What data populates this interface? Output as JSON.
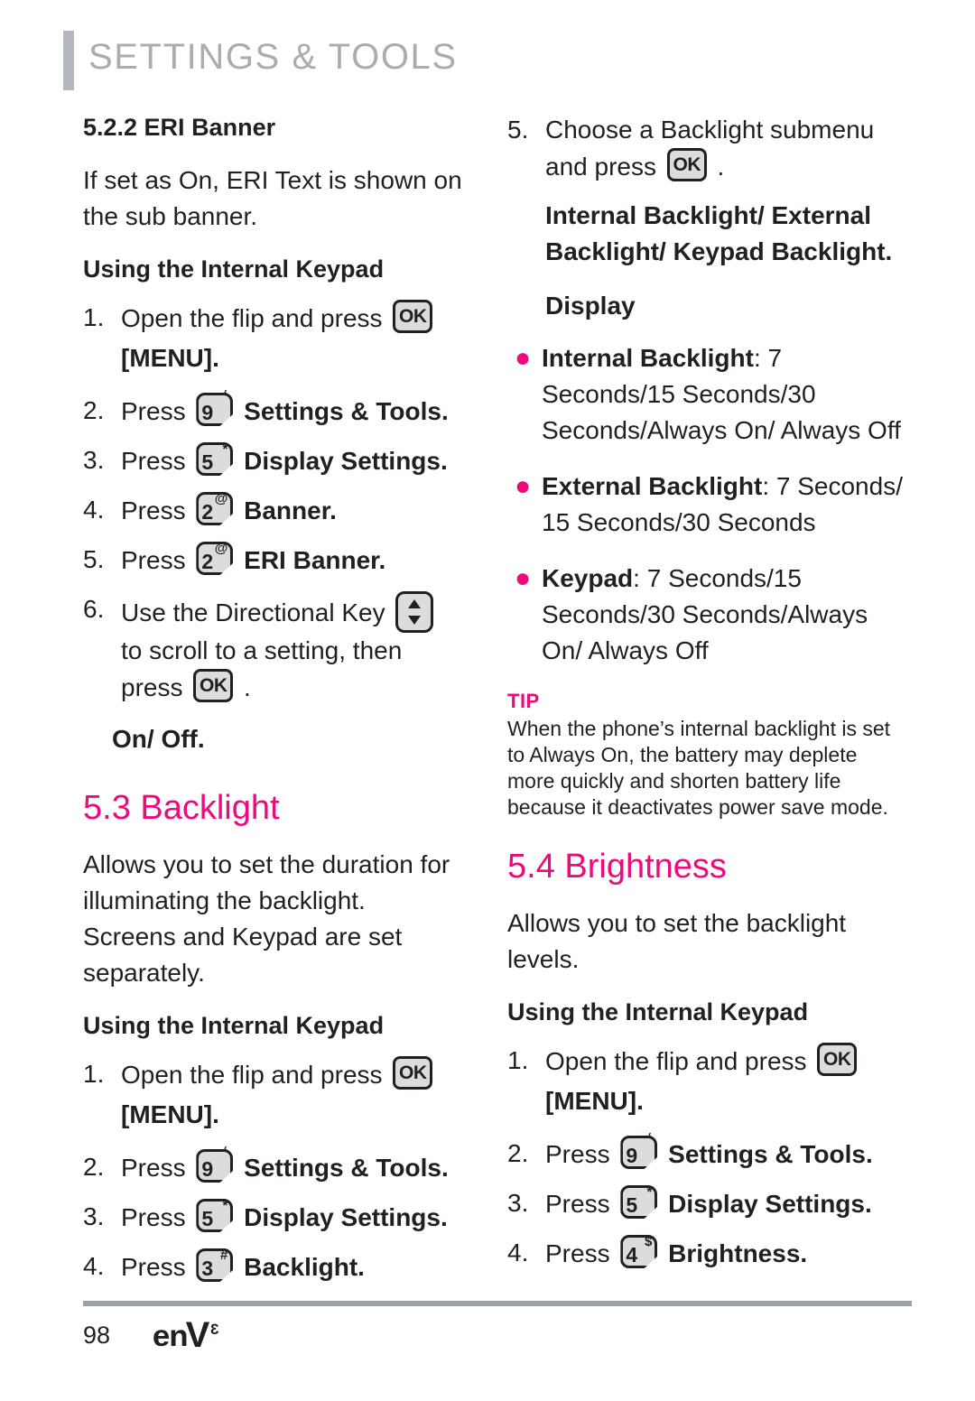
{
  "header": {
    "title": "SETTINGS & TOOLS"
  },
  "footer": {
    "page_number": "98",
    "brand_en": "en",
    "brand_v": "V",
    "brand_sup": "3"
  },
  "colors": {
    "accent": "#EC0A7D",
    "header_gray": "#A9ADB2",
    "rule_gray": "#9AA1A7",
    "key_fill": "#DCDCDC",
    "text": "#231F20"
  },
  "keys": {
    "ok_label": "OK",
    "k9": {
      "digit": "9",
      "sup": "‘"
    },
    "k5": {
      "digit": "5",
      "sup": "*"
    },
    "k2": {
      "digit": "2",
      "sup": "@"
    },
    "k3": {
      "digit": "3",
      "sup": "#"
    },
    "k4": {
      "digit": "4",
      "sup": "$"
    },
    "directional_name": "Directional Key"
  },
  "left_column": {
    "section_eri": {
      "heading": "5.2.2 ERI Banner",
      "intro": "If set as On, ERI Text is shown on the sub banner.",
      "subheading": "Using the Internal Keypad",
      "steps": [
        {
          "num": "1.",
          "pre": "Open the flip and press",
          "post": "",
          "menu": "[MENU]."
        },
        {
          "num": "2.",
          "pre": "Press",
          "key": "k9",
          "label": "Settings & Tools."
        },
        {
          "num": "3.",
          "pre": "Press",
          "key": "k5",
          "label": "Display Settings."
        },
        {
          "num": "4.",
          "pre": "Press",
          "key": "k2",
          "label": "Banner."
        },
        {
          "num": "5.",
          "pre": "Press",
          "key": "k2",
          "label": "ERI Banner."
        },
        {
          "num": "6.",
          "pre": "Use the Directional Key",
          "mid": "to scroll to a setting, then press",
          "post": "."
        }
      ],
      "result": "On/ Off."
    },
    "section_backlight": {
      "heading": "5.3 Backlight",
      "intro": "Allows you to set the duration for illuminating the backlight. Screens and Keypad are set separately.",
      "subheading": "Using the Internal Keypad",
      "steps": [
        {
          "num": "1.",
          "pre": "Open the flip and press",
          "menu": "[MENU]."
        },
        {
          "num": "2.",
          "pre": "Press",
          "key": "k9",
          "label": "Settings & Tools."
        },
        {
          "num": "3.",
          "pre": "Press",
          "key": "k5",
          "label": "Display Settings."
        },
        {
          "num": "4.",
          "pre": "Press",
          "key": "k3",
          "label": "Backlight."
        }
      ]
    }
  },
  "right_column": {
    "step5": {
      "num": "5.",
      "pre": "Choose a Backlight submenu and press",
      "post": "."
    },
    "submenu_options": "Internal Backlight/ External Backlight/ Keypad Backlight.",
    "display_label": "Display",
    "bullets": [
      {
        "label": "Internal Backlight",
        "value": ": 7 Seconds/15 Seconds/30 Seconds/Always On/ Always Off"
      },
      {
        "label": "External Backlight",
        "value": ": 7 Seconds/ 15 Seconds/30 Seconds"
      },
      {
        "label": "Keypad",
        "value": ": 7 Seconds/15 Seconds/30 Seconds/Always On/ Always Off"
      }
    ],
    "tip": {
      "label": "TIP",
      "text": "When the phone’s internal backlight is set to Always On, the battery may deplete more quickly and shorten battery life because it deactivates power save mode."
    },
    "section_brightness": {
      "heading": "5.4 Brightness",
      "intro": "Allows you to set the backlight levels.",
      "subheading": "Using the Internal Keypad",
      "steps": [
        {
          "num": "1.",
          "pre": "Open the flip and press",
          "menu": "[MENU]."
        },
        {
          "num": "2.",
          "pre": "Press",
          "key": "k9",
          "label": "Settings & Tools."
        },
        {
          "num": "3.",
          "pre": "Press",
          "key": "k5",
          "label": "Display Settings."
        },
        {
          "num": "4.",
          "pre": "Press",
          "key": "k4",
          "label": "Brightness."
        }
      ]
    }
  }
}
